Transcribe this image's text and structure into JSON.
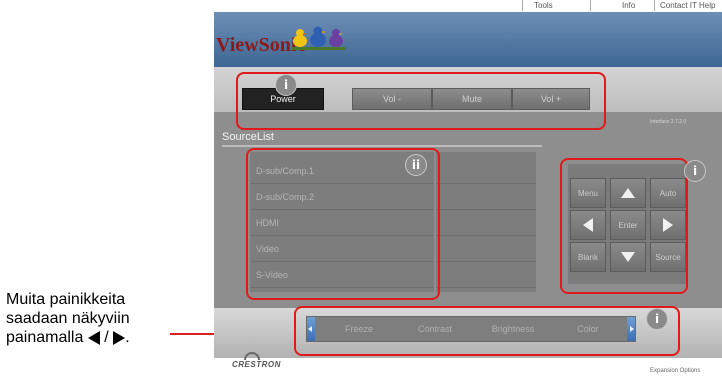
{
  "annotation": {
    "line1": "Muita painikkeita",
    "line2": "saadaan näkyviin",
    "line3_prefix": "painamalla",
    "line3_sep": "/",
    "line3_end": "."
  },
  "topnav": {
    "tools": "Tools",
    "info": "Info",
    "contact": "Contact IT Help"
  },
  "header": {
    "logo_text": "ViewSonic",
    "logo_color": "#8b1a1a"
  },
  "power_row": {
    "power": "Power",
    "vol_minus": "Vol -",
    "mute": "Mute",
    "vol_plus": "Vol +"
  },
  "interface_label": "Interface 2.7.2.0",
  "source": {
    "title": "SourceList",
    "items": [
      "D-sub/Comp.1",
      "D-sub/Comp.2",
      "HDMI",
      "Video",
      "S-Video"
    ]
  },
  "control": {
    "menu": "Menu",
    "auto": "Auto",
    "enter": "Enter",
    "blank": "Blank",
    "source": "Source",
    "up_icon": "arrow-up-icon",
    "down_icon": "arrow-down-icon",
    "left_icon": "arrow-left-icon",
    "right_icon": "arrow-right-icon"
  },
  "scroll_menu": {
    "items": [
      "Freeze",
      "Contrast",
      "Brightness",
      "Color"
    ]
  },
  "footer": {
    "crestron": "CRESTRON",
    "expansion": "Expansion Options"
  },
  "badges": {
    "i": "i",
    "ii": "ii"
  },
  "colors": {
    "highlight_red": "#e01a1a",
    "scroll_cap_blue": "#3b6fb3"
  }
}
